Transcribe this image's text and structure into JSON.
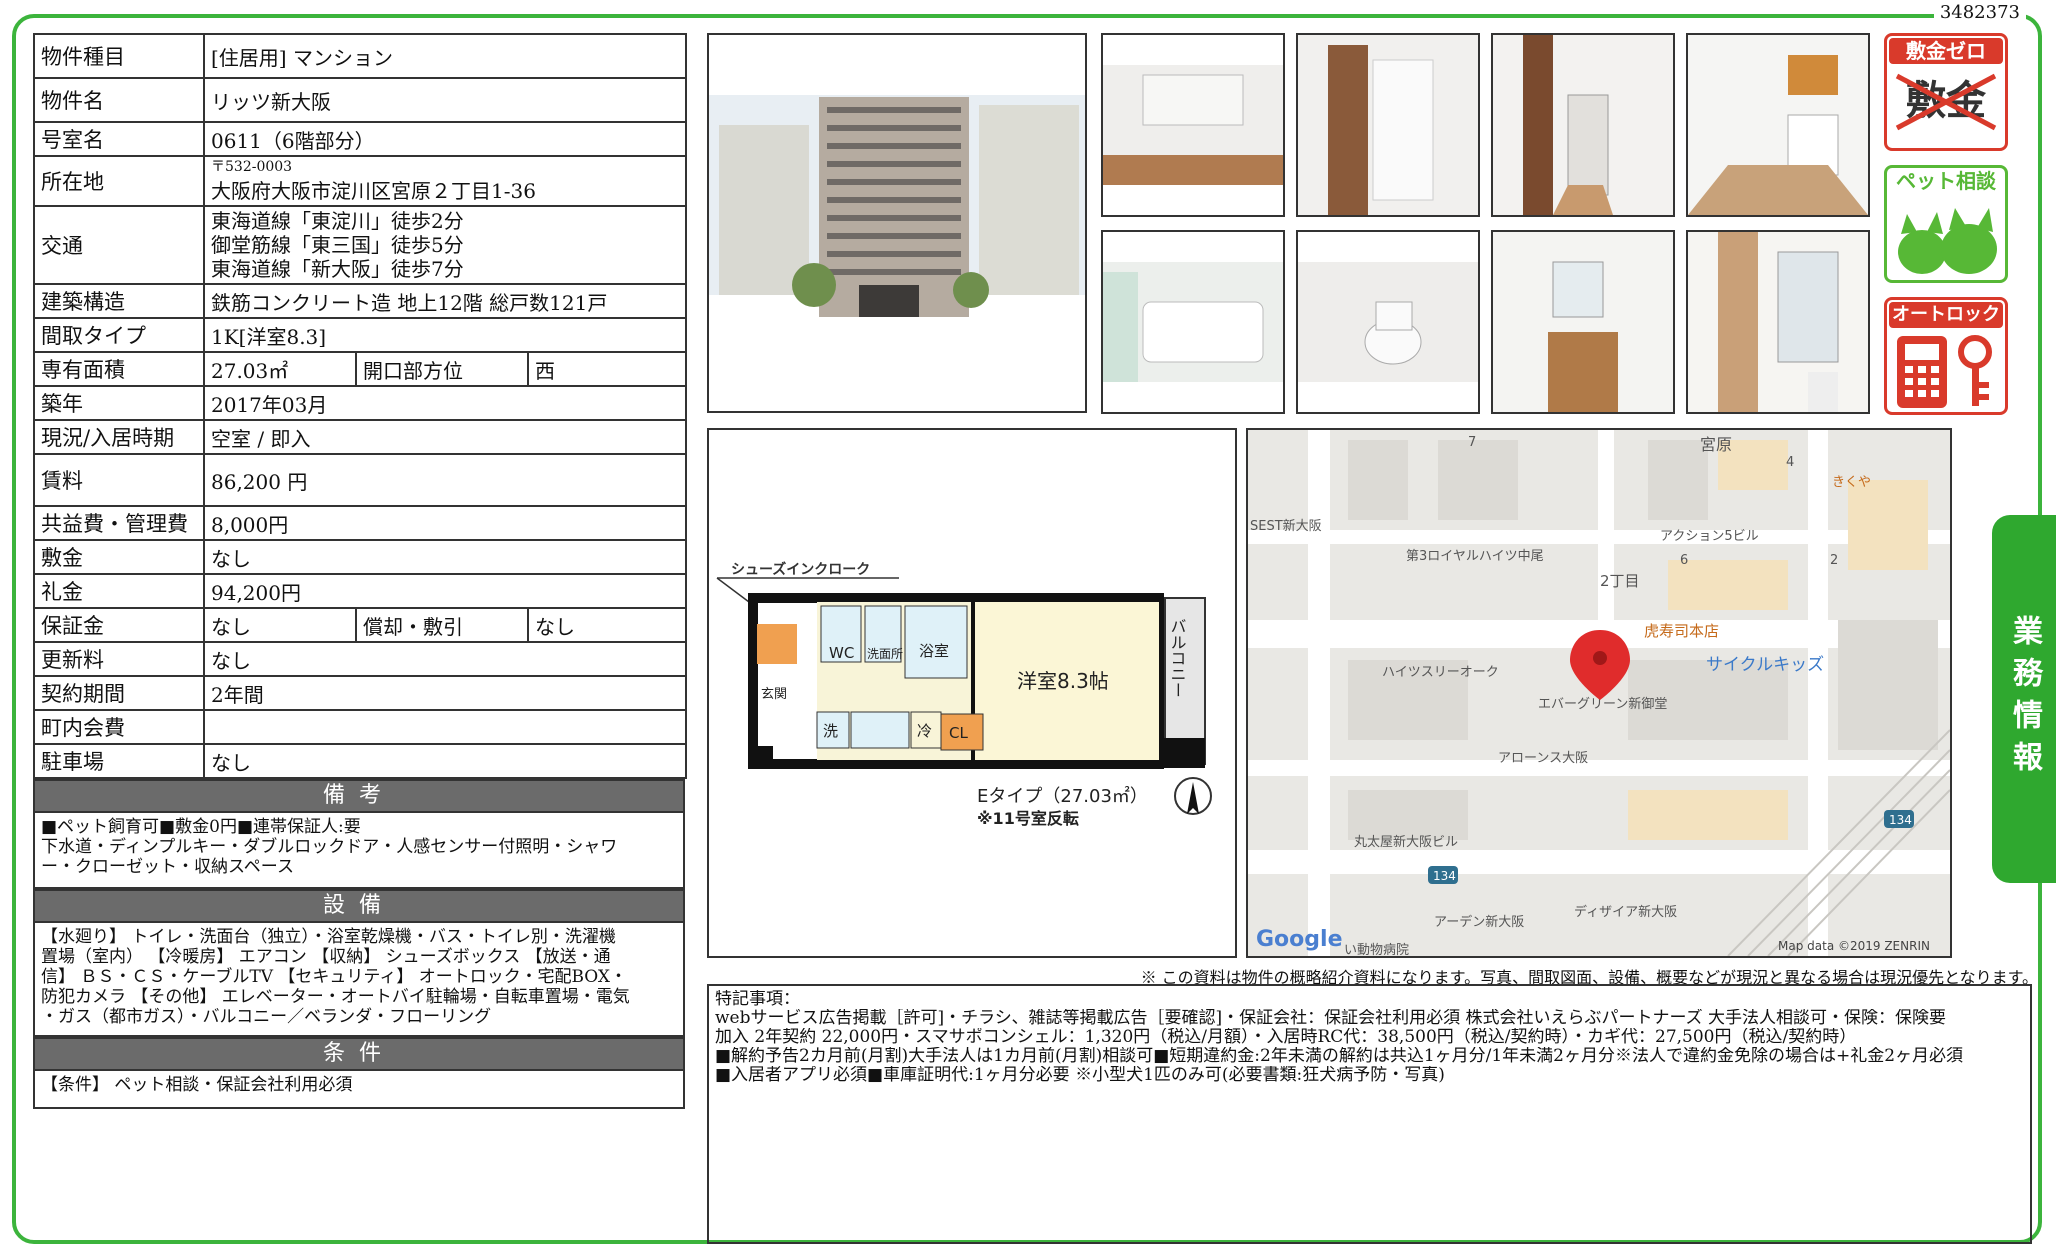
{
  "doc_id": "3482373",
  "property": {
    "type_label": "物件種目",
    "type_value": "[住居用] マンション",
    "name_label": "物件名",
    "name_value": "リッツ新大阪",
    "room_label": "号室名",
    "room_value": "0611（6階部分）",
    "address_label": "所在地",
    "postal": "〒532-0003",
    "address_value": "大阪府大阪市淀川区宮原２丁目1-36",
    "access_label": "交通",
    "access_lines": [
      "東海道線「東淀川」徒歩2分",
      "御堂筋線「東三国」徒歩5分",
      "東海道線「新大阪」徒歩7分"
    ],
    "structure_label": "建築構造",
    "structure_value": "鉄筋コンクリート造 地上12階 総戸数121戸",
    "layout_label": "間取タイプ",
    "layout_value": "1K[洋室8.3]",
    "area_label": "専有面積",
    "area_value": "27.03㎡",
    "direction_label": "開口部方位",
    "direction_value": "西",
    "built_label": "築年",
    "built_value": "2017年03月",
    "status_label": "現況/入居時期",
    "status_value": "空室 / 即入",
    "rent_label": "賃料",
    "rent_value": "86,200 円",
    "fee_label": "共益費・管理費",
    "fee_value": "8,000円",
    "deposit_label": "敷金",
    "deposit_value": "なし",
    "key_money_label": "礼金",
    "key_money_value": "94,200円",
    "guarantee_label": "保証金",
    "guarantee_value": "なし",
    "amort_label": "償却・敷引",
    "amort_value": "なし",
    "renewal_label": "更新料",
    "renewal_value": "なし",
    "contract_label": "契約期間",
    "contract_value": "2年間",
    "town_fee_label": "町内会費",
    "town_fee_value": "",
    "parking_label": "駐車場",
    "parking_value": "なし"
  },
  "sections": {
    "remarks_head": "備考",
    "remarks_body": "■ペット飼育可■敷金0円■連帯保証人:要\n下水道・ディンプルキー・ダブルロックドア・人感センサー付照明・シャワ\nー・クローゼット・収納スペース",
    "equipment_head": "設備",
    "equipment_body": "【水廻り】 トイレ・洗面台（独立）・浴室乾燥機・バス・トイレ別・洗濯機\n置場（室内） 【冷暖房】 エアコン 【収納】 シューズボックス 【放送・通\n信】 ＢＳ・ＣＳ・ケーブルTV 【セキュリティ】 オートロック・宅配BOX・\n防犯カメラ 【その他】 エレベーター・オートバイ駐輪場・自転車置場・電気\n・ガス（都市ガス）・バルコニー／ベランダ・フローリング",
    "conditions_head": "条件",
    "conditions_body": "【条件】 ペット相談・保証会社利用必須"
  },
  "badges": {
    "deposit_zero_top": "敷金ゼロ",
    "deposit_zero_crossed": "敷金",
    "pet": "ペット相談",
    "autolock": "オートロック"
  },
  "side_tab": "業務情報",
  "floor_plan": {
    "shoes_label": "シューズインクローク",
    "wc": "WC",
    "washroom": "洗面所",
    "bath": "浴室",
    "room": "洋室8.3帖",
    "balcony": "バルコニー",
    "entrance": "玄関",
    "wash": "洗",
    "fridge": "冷",
    "closet": "CL",
    "type": "Eタイプ（27.03㎡）",
    "reversed": "※11号室反転"
  },
  "map": {
    "labels": {
      "miyahara": "宮原",
      "kikuya": "きくや",
      "sest": "SEST新大阪",
      "royal": "第3ロイヤルハイツ中尾",
      "action": "アクション5ビル",
      "chome": "2丁目",
      "torasushi": "虎寿司本店",
      "cycle": "サイクルキッズ",
      "heights": "ハイツスリーオーク",
      "evergreen": "エバーグリーン新御堂",
      "arones": "アローンス大阪",
      "marutaya": "丸太屋新大阪ビル",
      "arden": "アーデン新大阪",
      "desiria": "ディザイア新大阪",
      "hospital": "い動物病院",
      "n7": "7",
      "n4": "4",
      "n6": "6",
      "n2": "2",
      "r134a": "134",
      "r134b": "134"
    },
    "google": "Google",
    "credit": "Map data ©2019 ZENRIN"
  },
  "note": "※ この資料は物件の概略紹介資料になります。写真、間取図面、設備、概要などが現況と異なる場合は現況優先となります。",
  "special": {
    "title": "特記事項：",
    "lines": [
      "webサービス広告掲載［許可]・チラシ、雑誌等掲載広告［要確認]・保証会社：保証会社利用必須 株式会社いえらぶパートナーズ 大手法人相談可・保険：保険要",
      "加入 2年契約 22,000円・スマサポコンシェル：1,320円（税込/月額）・入居時RC代：38,500円（税込/契約時）・カギ代：27,500円（税込/契約時）",
      "■解約予告2カ月前(月割)大手法人は1カ月前(月割)相談可■短期違約金:2年未満の解約は共込1ヶ月分/1年未満2ヶ月分※法人で違約金免除の場合は+礼金2ヶ月必須",
      "■入居者アプリ必須■車庫証明代:1ヶ月分必要 ※小型犬1匹のみ可(必要書類:狂犬病予防・写真)"
    ]
  },
  "colors": {
    "frame_green": "#3cb43c",
    "badge_red": "#d93a2b",
    "badge_green": "#57b836",
    "header_gray": "#6b6b6b"
  }
}
